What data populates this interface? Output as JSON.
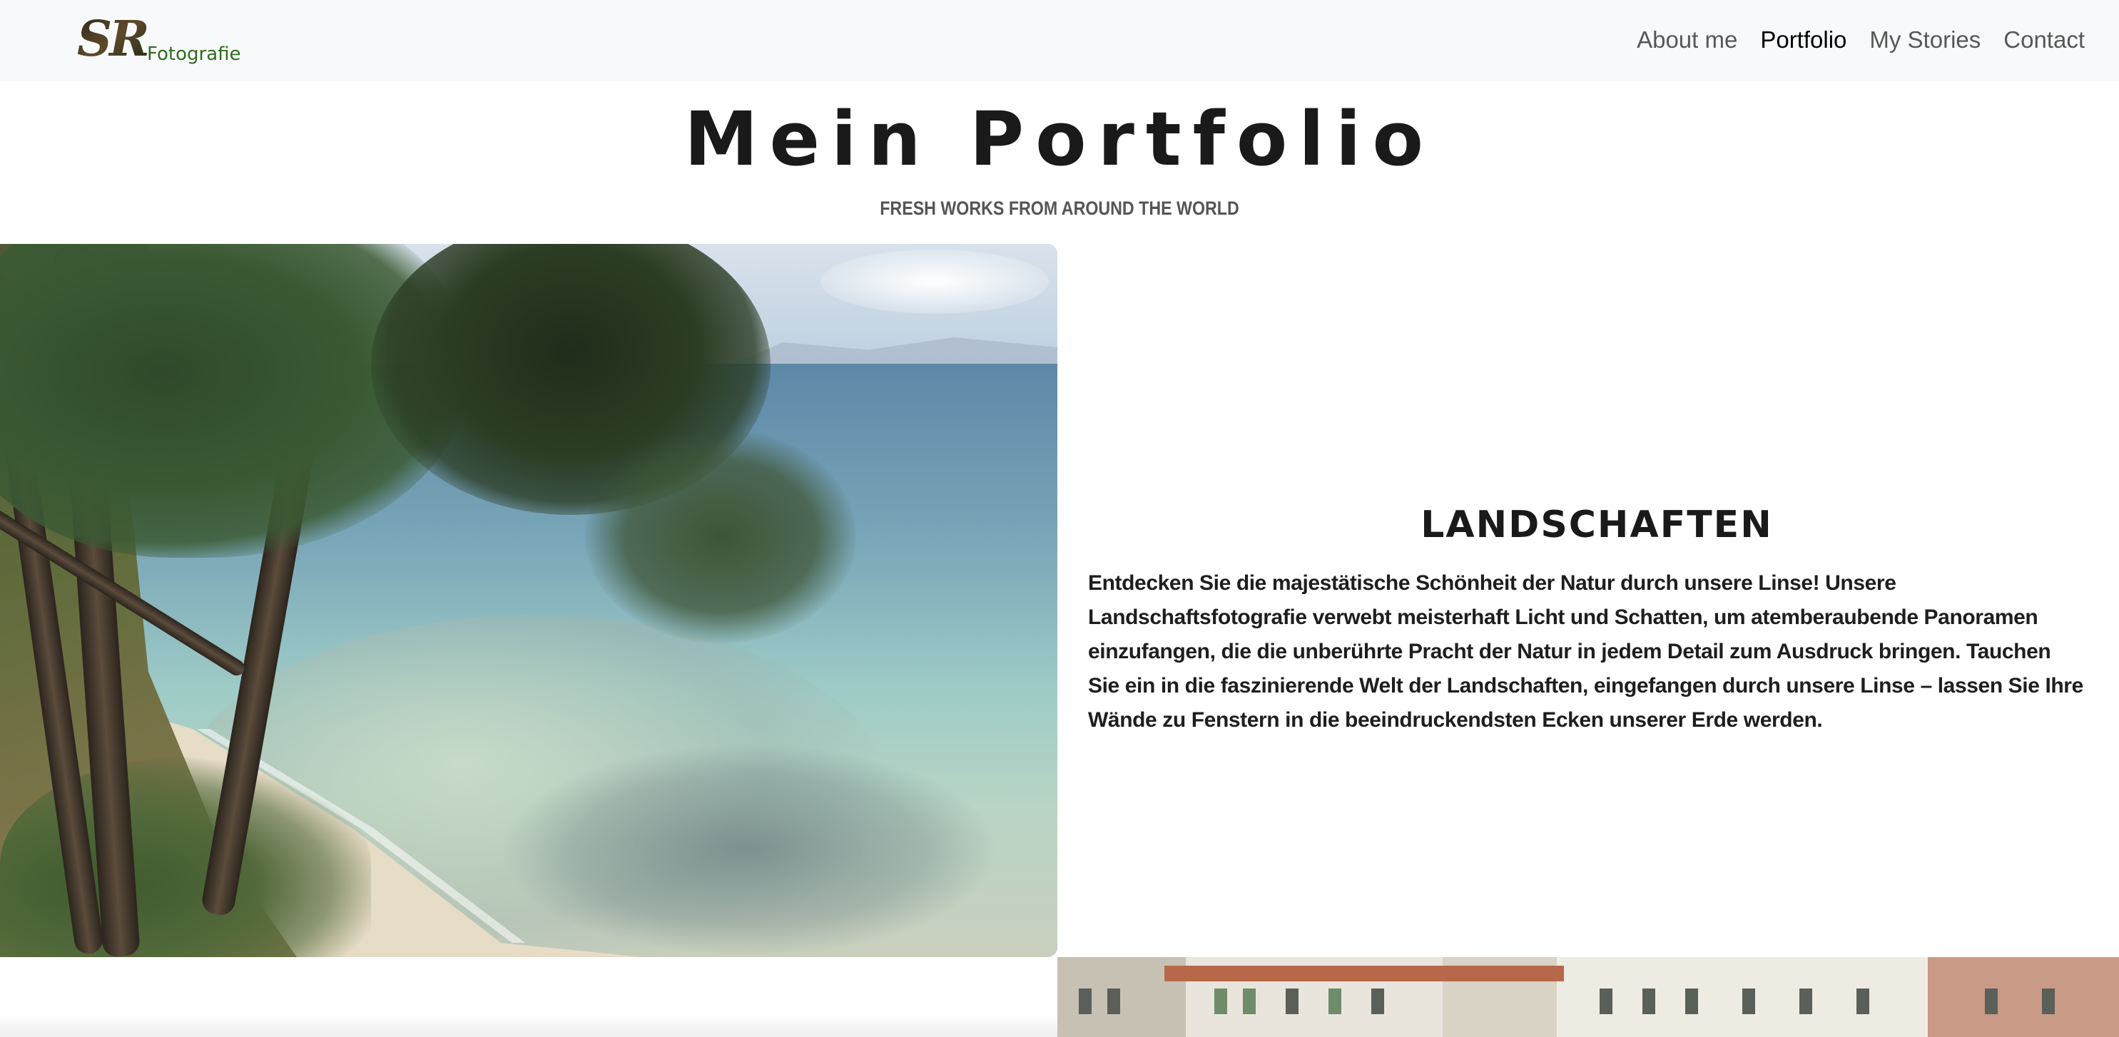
{
  "brand": {
    "logo_name": "SR Fotografie logo",
    "logo_letters": "SR",
    "logo_text": "Fotografie"
  },
  "nav": {
    "items": [
      {
        "label": "About me",
        "active": false
      },
      {
        "label": "Portfolio",
        "active": true
      },
      {
        "label": "My Stories",
        "active": false
      },
      {
        "label": "Contact",
        "active": false
      }
    ]
  },
  "header": {
    "title": "Mein Portfolio",
    "subtitle": "FRESH WORKS FROM AROUND THE WORLD"
  },
  "section": {
    "title": "LANDSCHAFTEN",
    "text": "Entdecken Sie die majestätische Schönheit der Natur durch unsere Linse! Unsere Landschaftsfotografie verwebt meisterhaft Licht und Schatten, um atemberaubende Panoramen einzufangen, die die unberührte Pracht der Natur in jedem Detail zum Ausdruck bringen. Tauchen Sie ein in die faszinierende Welt der Landschaften, eingefangen durch unsere Linse – lassen Sie Ihre Wände zu Fenstern in die beeindruckendsten Ecken unserer Erde werden."
  },
  "colors": {
    "navbar_bg": "#f8f9fa",
    "nav_text": "#595959",
    "nav_active": "#000000",
    "logo_dark": "#3a3020",
    "logo_green": "#2f6b1f"
  }
}
